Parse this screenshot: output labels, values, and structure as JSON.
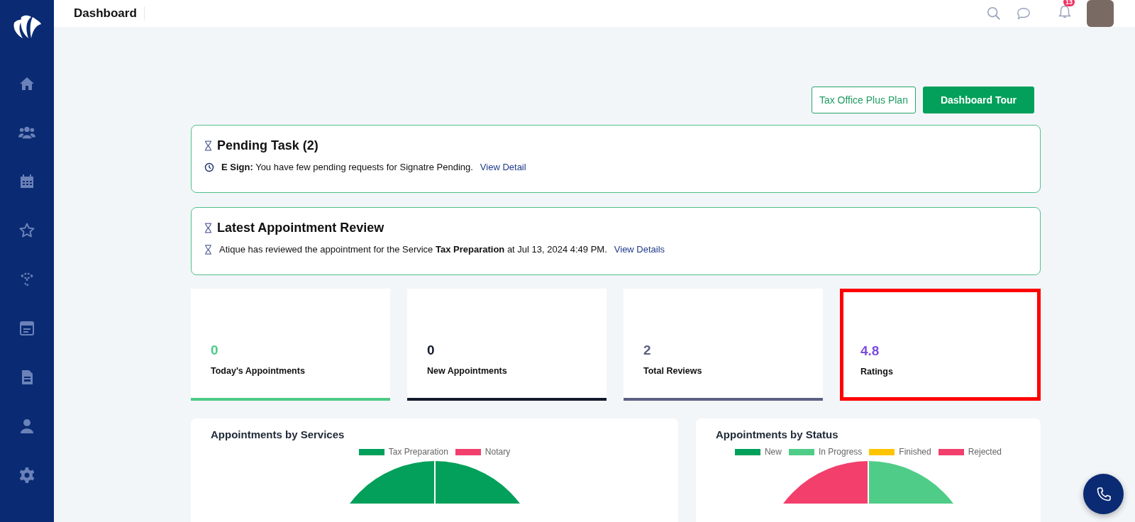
{
  "header": {
    "title": "Dashboard",
    "notification_count": "13"
  },
  "actions": [
    {
      "kind": "outline",
      "label": "Tax Office Plus Plan"
    },
    {
      "kind": "solid",
      "label": "Dashboard Tour"
    }
  ],
  "pending_task": {
    "title": "Pending Task (2)",
    "items": [
      {
        "text": "**E Sign:** You have few pending requests for Signatre Pending.",
        "link": "View Detail"
      }
    ]
  },
  "latest_review": {
    "title": "Latest Appointment Review",
    "items": [
      {
        "text": "Atique has reviewed the appointment for the Service **Tax Preparation** at Jul 13, 2024 4:49 PM.",
        "link": "View Details"
      }
    ]
  },
  "stats": [
    {
      "value": "0",
      "label": "Today's Appointments",
      "color": "#4ecb87",
      "highlighted": false
    },
    {
      "value": "0",
      "label": "New Appointments",
      "color": "#141a2e",
      "highlighted": false
    },
    {
      "value": "2",
      "label": "Total Reviews",
      "color": "#5b6181",
      "highlighted": false
    },
    {
      "value": "4.8",
      "label": "Ratings",
      "color": "#7b4fe0",
      "highlighted": true
    }
  ],
  "charts": [
    {
      "title": "Appointments by Services",
      "legend": [
        {
          "label": "Tax Preparation",
          "color": "#02a05a"
        },
        {
          "label": "Notary",
          "color": "#f23f6c"
        }
      ]
    },
    {
      "title": "Appointments by Status",
      "legend": [
        {
          "label": "New",
          "color": "#02a05a"
        },
        {
          "label": "In Progress",
          "color": "#4fcd88"
        },
        {
          "label": "Finished",
          "color": "#ffc400"
        },
        {
          "label": "Rejected",
          "color": "#f23f6c"
        }
      ]
    }
  ]
}
